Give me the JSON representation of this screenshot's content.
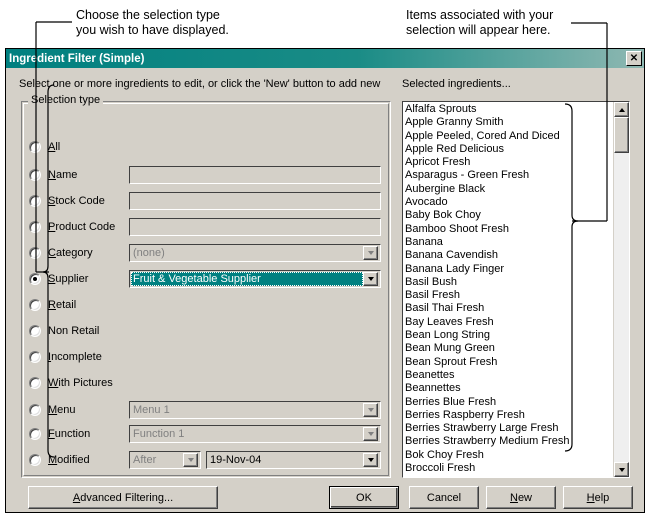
{
  "annotations": {
    "left_callout": "Choose the selection type\nyou wish to have displayed.",
    "right_callout": "Items associated with your\nselection will appear here."
  },
  "window": {
    "title": "Ingredient Filter (Simple)",
    "close_icon": "close-icon",
    "close_label": "✕"
  },
  "dialog": {
    "instruction": "Select one or more ingredients to edit, or click the 'New' button to add new",
    "list_label": "Selected ingredients..."
  },
  "selection_group": {
    "legend": "Selection type",
    "rows": [
      {
        "label": "All",
        "mnemonic": "A",
        "checked": false,
        "field": null
      },
      {
        "label": "Name",
        "mnemonic": "N",
        "checked": false,
        "field": {
          "type": "textbox",
          "value": "",
          "placeholder": ""
        }
      },
      {
        "label": "Stock Code",
        "mnemonic": "S",
        "checked": false,
        "field": {
          "type": "textbox",
          "value": "",
          "placeholder": ""
        }
      },
      {
        "label": "Product Code",
        "mnemonic": "P",
        "checked": false,
        "field": {
          "type": "textbox",
          "value": "",
          "placeholder": ""
        }
      },
      {
        "label": "Category",
        "mnemonic": "C",
        "checked": false,
        "field": {
          "type": "combo",
          "value": "(none)",
          "disabled": true
        }
      },
      {
        "label": "Supplier",
        "mnemonic": "S",
        "checked": true,
        "field": {
          "type": "combo-selected",
          "value": "Fruit & Vegetable Supplier",
          "disabled": false
        }
      },
      {
        "label": "Retail",
        "mnemonic": "R",
        "checked": false,
        "field": null
      },
      {
        "label": "Non Retail",
        "mnemonic": "",
        "checked": false,
        "field": null
      },
      {
        "label": "Incomplete",
        "mnemonic": "I",
        "checked": false,
        "field": null
      },
      {
        "label": "With Pictures",
        "mnemonic": "W",
        "checked": false,
        "field": null
      },
      {
        "label": "Menu",
        "mnemonic": "M",
        "checked": false,
        "field": {
          "type": "combo",
          "value": "Menu 1",
          "disabled": true
        }
      },
      {
        "label": "Function",
        "mnemonic": "F",
        "checked": false,
        "field": {
          "type": "combo",
          "value": "Function 1",
          "disabled": true
        }
      },
      {
        "label": "Modified",
        "mnemonic": "M",
        "checked": false,
        "field": {
          "type": "combo-pair",
          "value": "After",
          "disabled": true,
          "value2": "19-Nov-04",
          "disabled2": false
        }
      }
    ]
  },
  "ingredients": [
    "Alfalfa Sprouts",
    "Apple Granny Smith",
    "Apple Peeled, Cored And Diced",
    "Apple Red Delicious",
    "Apricot Fresh",
    "Asparagus - Green Fresh",
    "Aubergine Black",
    "Avocado",
    "Baby Bok Choy",
    "Bamboo Shoot Fresh",
    "Banana",
    "Banana Cavendish",
    "Banana Lady Finger",
    "Basil Bush",
    "Basil Fresh",
    "Basil Thai Fresh",
    "Bay Leaves Fresh",
    "Bean Long String",
    "Bean Mung Green",
    "Bean Sprout Fresh",
    "Beanettes",
    "Beannettes",
    "Berries Blue Fresh",
    "Berries Raspberry Fresh",
    "Berries Strawberry Large Fresh",
    "Berries Strawberry Medium Fresh",
    "Bok Choy Fresh",
    "Broccoli Fresh"
  ],
  "scrollbar": {
    "up_icon": "scroll-up-arrow-icon",
    "down_icon": "scroll-down-arrow-icon"
  },
  "buttons": {
    "advanced": {
      "label": "Advanced Filtering...",
      "mnemonic": "A"
    },
    "ok": {
      "label": "OK",
      "mnemonic": ""
    },
    "cancel": {
      "label": "Cancel",
      "mnemonic": ""
    },
    "new": {
      "label": "New",
      "mnemonic": "N"
    },
    "help": {
      "label": "Help",
      "mnemonic": "H"
    }
  },
  "colors": {
    "titlebar_teal": "#008080",
    "dialog_face": "#d4d0c8",
    "selection_highlight": "#008080",
    "page_background": "#ffffff"
  }
}
